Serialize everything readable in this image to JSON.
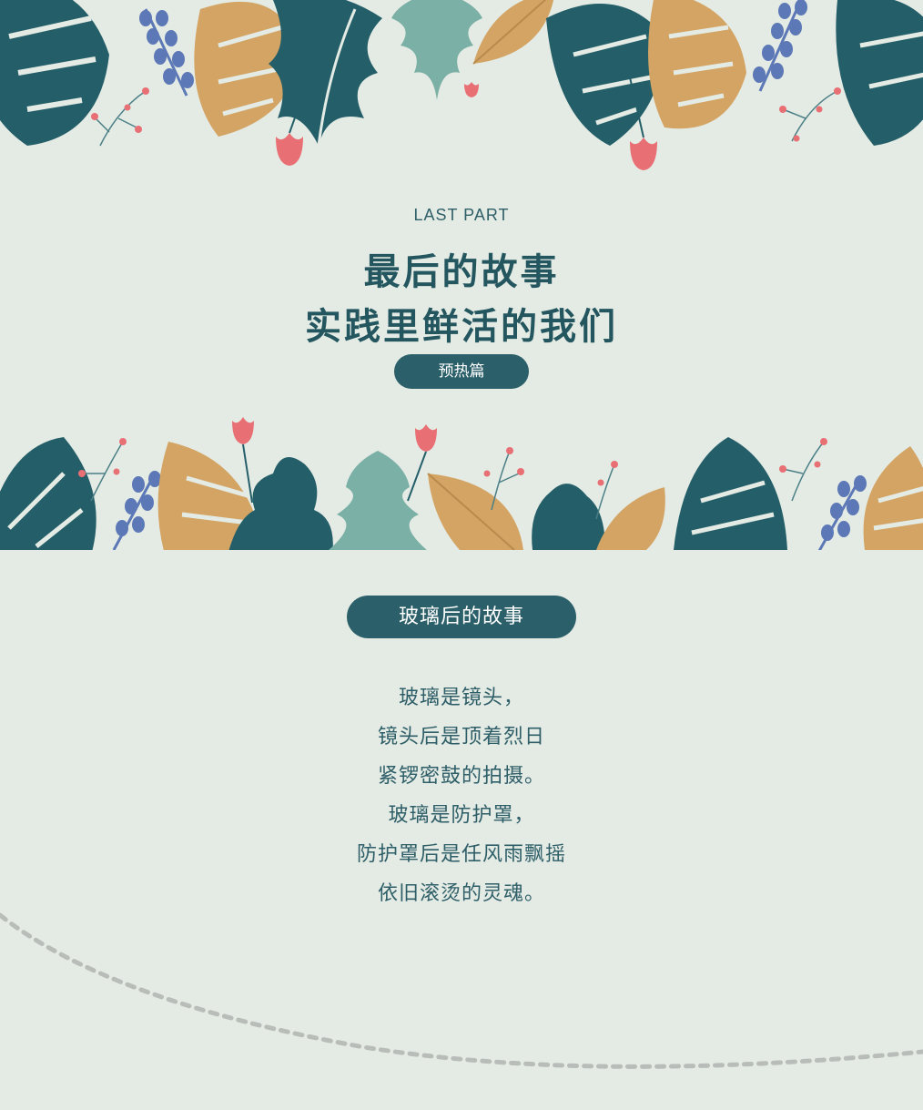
{
  "header": {
    "eyebrow": "LAST PART",
    "title_line1": "最后的故事",
    "title_line2": "实践里鲜活的我们",
    "tag_label": "预热篇"
  },
  "section": {
    "heading": "玻璃后的故事",
    "poem_lines": [
      "玻璃是镜头，",
      "镜头后是顶着烈日",
      "紧锣密鼓的拍摄。",
      "玻璃是防护罩，",
      "防护罩后是任风雨飘摇",
      "依旧滚烫的灵魂。"
    ]
  },
  "colors": {
    "background": "#e4ebe4",
    "teal_dark": "#245f69",
    "teal_light": "#7ab0a6",
    "mustard": "#d3a464",
    "lavender_blue": "#5c78b6",
    "coral": "#e86f74",
    "dash_gray": "#b9bdb9"
  },
  "decorations": {
    "top_band": [
      "monstera-leaf-icon",
      "oak-leaf-icon",
      "fern-leaf-icon",
      "berry-sprig-icon",
      "tulip-bud-icon"
    ],
    "middle_band": [
      "monstera-leaf-icon",
      "oak-leaf-icon",
      "fern-leaf-icon",
      "berry-sprig-icon",
      "tulip-bud-icon"
    ]
  }
}
